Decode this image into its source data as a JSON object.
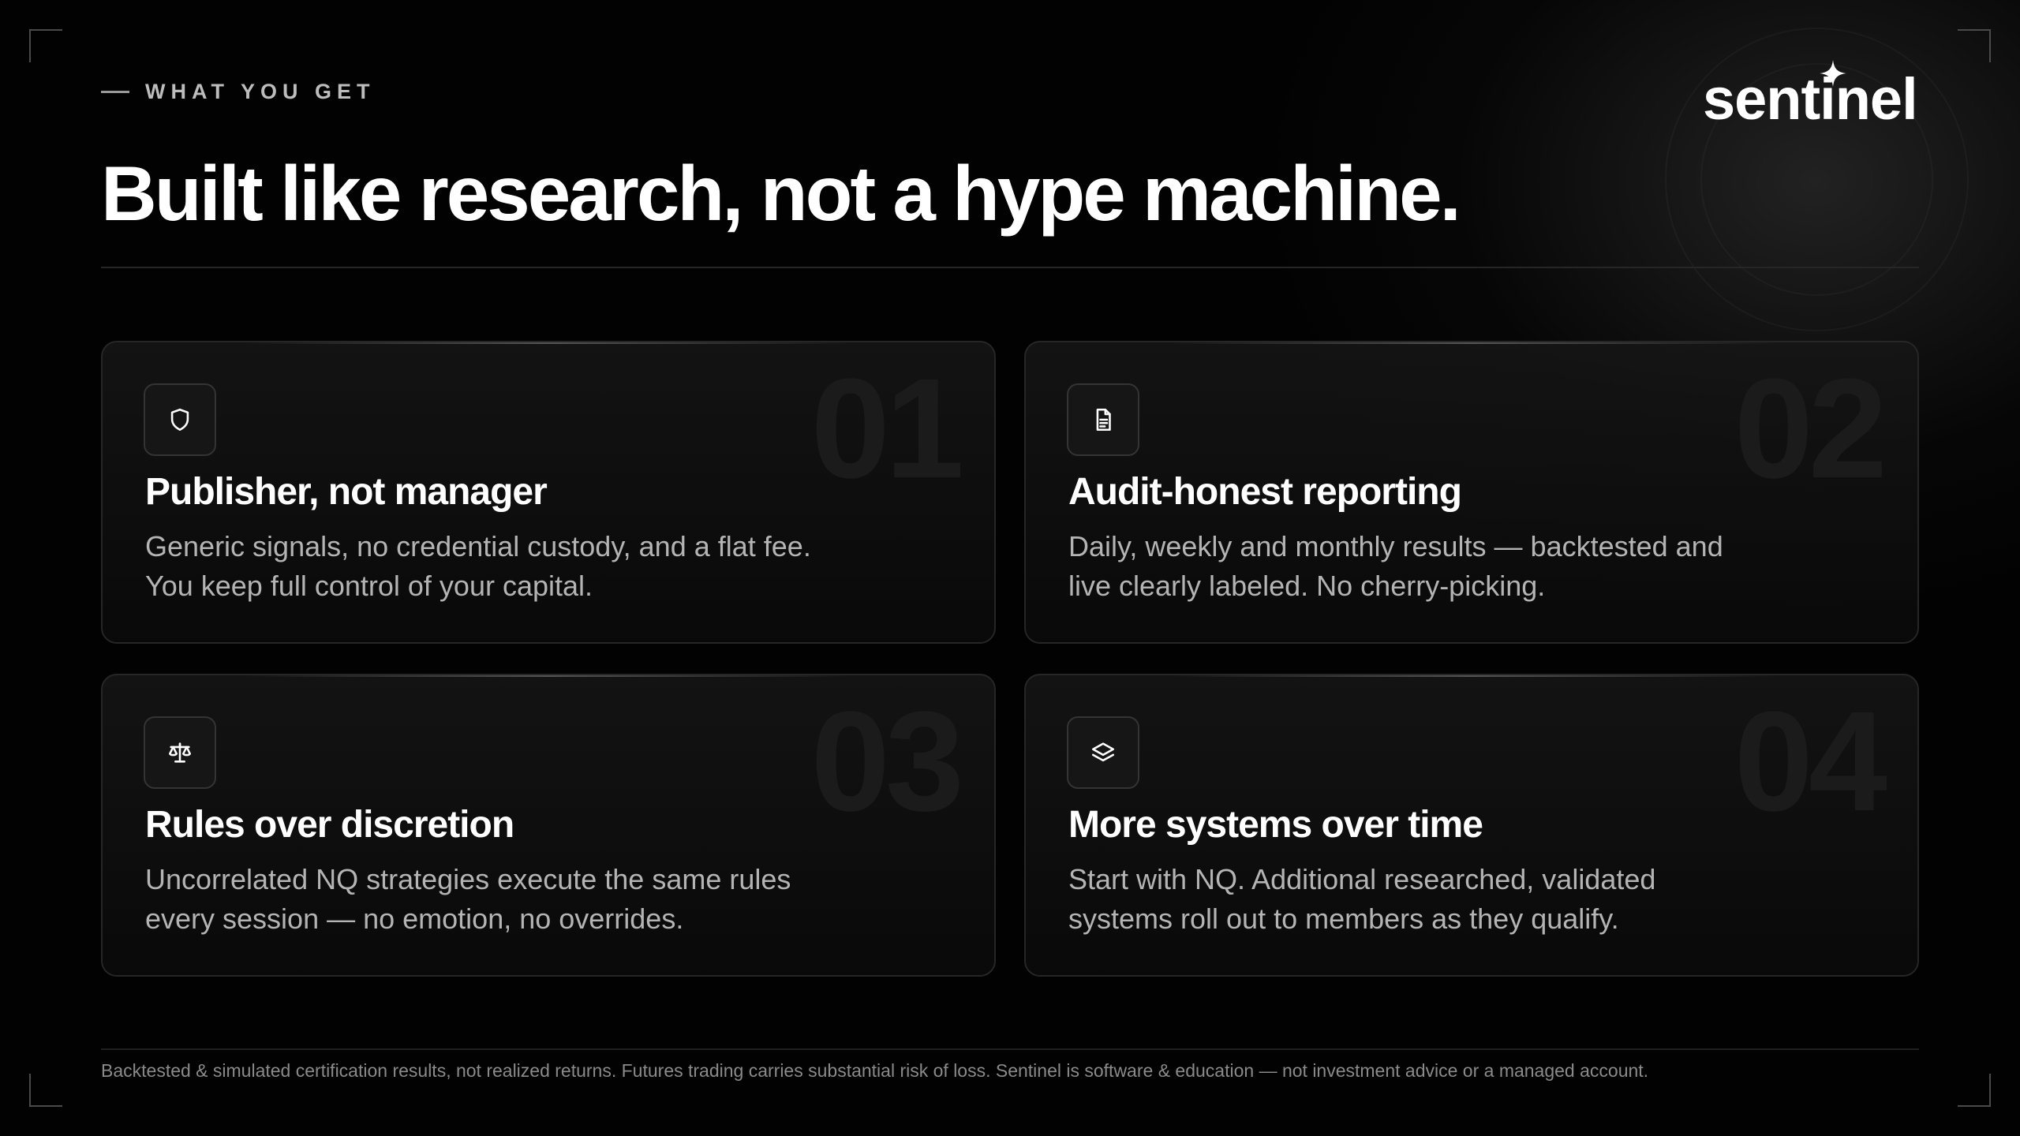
{
  "header": {
    "eyebrow": "WHAT YOU GET",
    "title": "Built like research, not a hype machine.",
    "logo": "sentinel"
  },
  "cards": [
    {
      "number": "01",
      "icon": "shield-icon",
      "title": "Publisher, not manager",
      "description": "Generic signals, no credential custody, and a flat fee. You keep full control of your capital."
    },
    {
      "number": "02",
      "icon": "document-icon",
      "title": "Audit-honest reporting",
      "description": "Daily, weekly and monthly results — backtested and live clearly labeled. No cherry-picking."
    },
    {
      "number": "03",
      "icon": "scale-icon",
      "title": "Rules over discretion",
      "description": "Uncorrelated NQ strategies execute the same rules every session — no emotion, no overrides."
    },
    {
      "number": "04",
      "icon": "layers-icon",
      "title": "More systems over time",
      "description": "Start with NQ. Additional researched, validated systems roll out to members as they qualify."
    }
  ],
  "footer": {
    "disclaimer": "Backtested & simulated certification results, not realized returns. Futures trading carries substantial risk of loss. Sentinel is software & education — not investment advice or a managed account."
  },
  "colors": {
    "background": "#020202",
    "card_border": "#262626",
    "text_primary": "#ffffff",
    "text_secondary": "#b4b4b4",
    "text_muted": "#8a8a8a"
  }
}
